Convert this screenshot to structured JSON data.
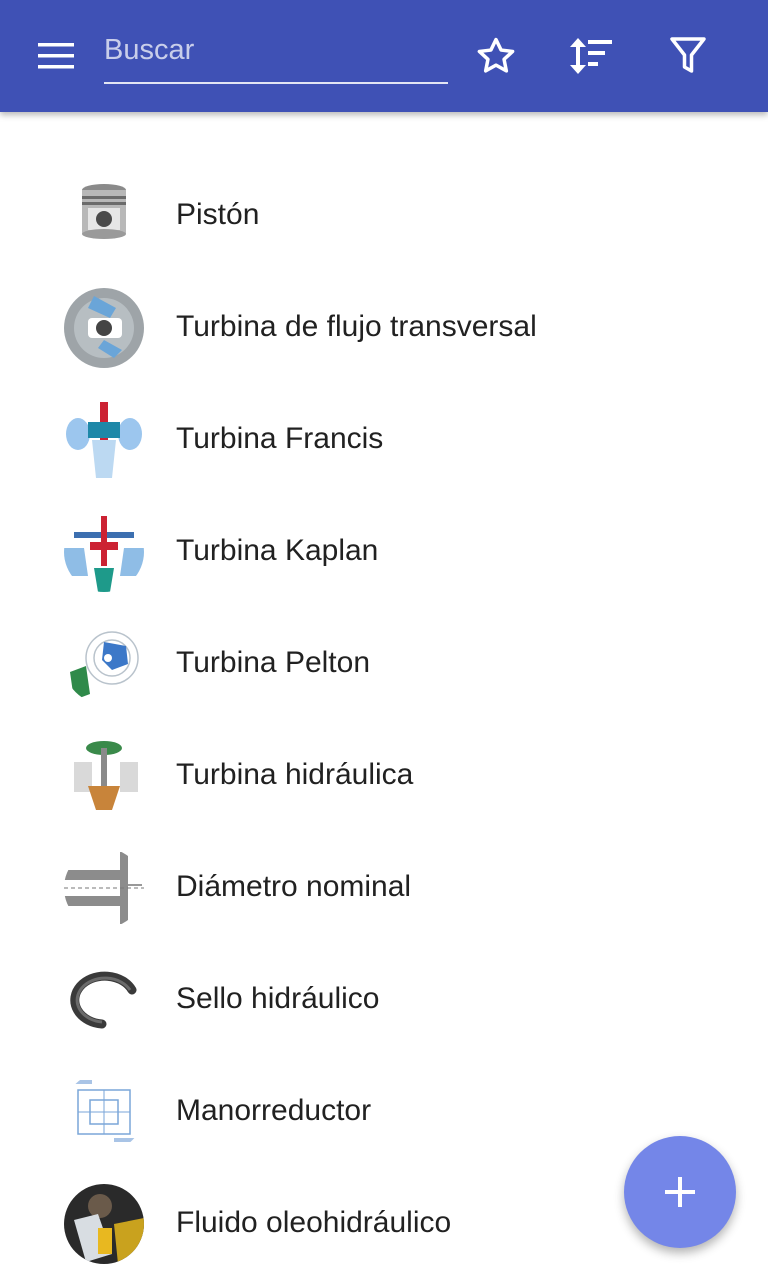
{
  "toolbar": {
    "menu_icon": "hamburger-menu-icon",
    "search_placeholder": "Buscar",
    "search_value": "",
    "favorites_icon": "star-outline-icon",
    "sort_icon": "sort-icon",
    "filter_icon": "filter-icon",
    "background_color": "#3f51b5"
  },
  "items": [
    {
      "label": "Pistón",
      "icon": "piston-thumbnail"
    },
    {
      "label": "Turbina de flujo transversal",
      "icon": "crossflow-turbine-thumbnail"
    },
    {
      "label": "Turbina Francis",
      "icon": "francis-turbine-thumbnail"
    },
    {
      "label": "Turbina Kaplan",
      "icon": "kaplan-turbine-thumbnail"
    },
    {
      "label": "Turbina Pelton",
      "icon": "pelton-turbine-thumbnail"
    },
    {
      "label": "Turbina hidráulica",
      "icon": "hydraulic-turbine-thumbnail"
    },
    {
      "label": "Diámetro nominal",
      "icon": "nominal-diameter-thumbnail"
    },
    {
      "label": "Sello hidráulico",
      "icon": "hydraulic-seal-thumbnail"
    },
    {
      "label": "Manorreductor",
      "icon": "pressure-reducer-thumbnail"
    },
    {
      "label": "Fluido oleohidráulico",
      "icon": "hydraulic-fluid-thumbnail"
    }
  ],
  "fab": {
    "icon": "plus-icon",
    "color": "#7486e8"
  }
}
